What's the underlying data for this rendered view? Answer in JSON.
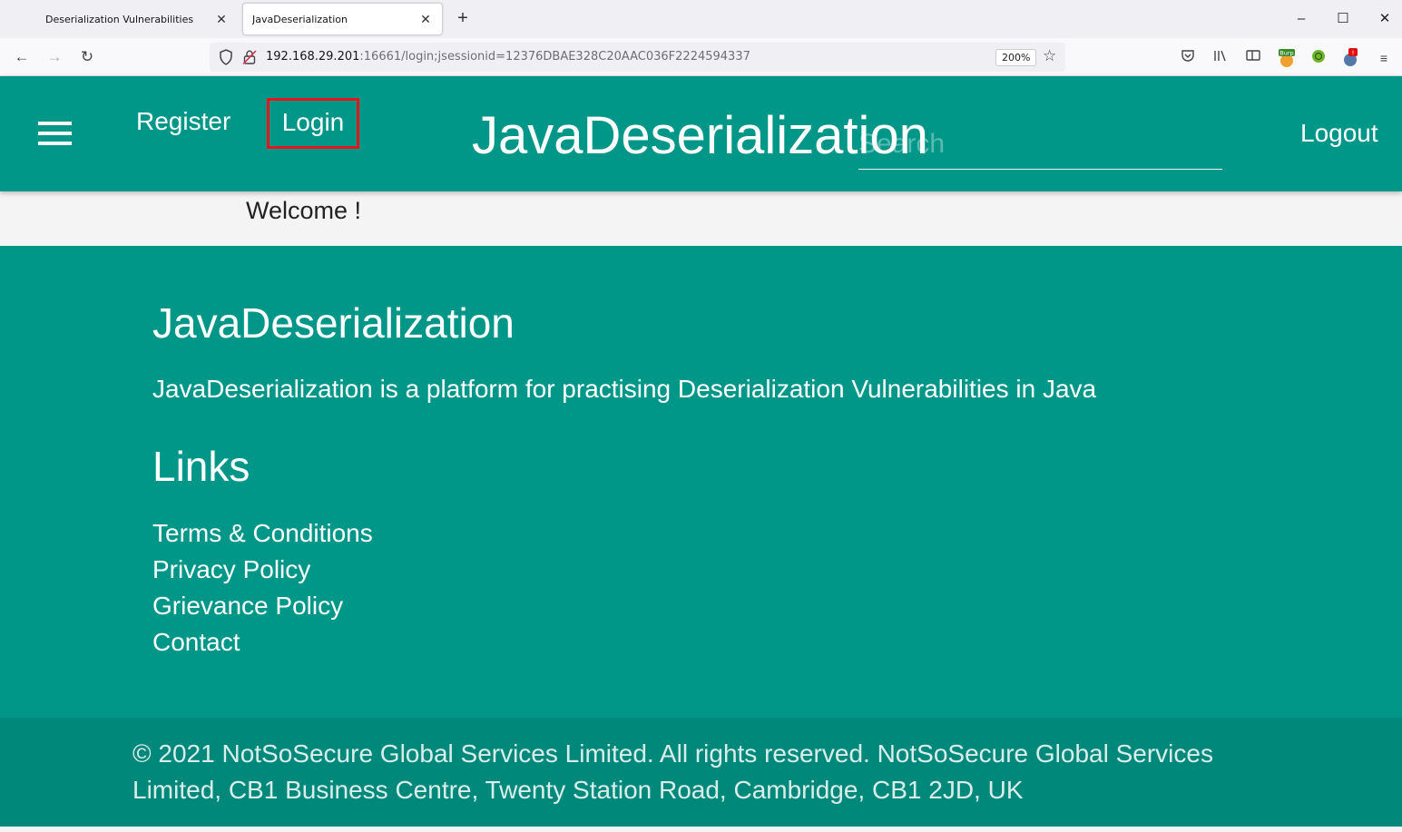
{
  "browser": {
    "tabs": [
      {
        "label": "Deserialization Vulnerabilities",
        "active": false
      },
      {
        "label": "JavaDeserialization",
        "active": true
      }
    ],
    "url_host": "192.168.29.201",
    "url_rest": ":16661/login;jsessionid=12376DBAE328C20AAC036F2224594337",
    "zoom": "200%"
  },
  "header": {
    "register": "Register",
    "login": "Login",
    "brand": "JavaDeserialization",
    "search_placeholder": "Search",
    "logout": "Logout"
  },
  "main": {
    "welcome": "Welcome !"
  },
  "footer": {
    "title": "JavaDeserialization",
    "description": "JavaDeserialization is a platform for practising Deserialization Vulnerabilities in Java",
    "links_title": "Links",
    "links": [
      "Terms & Conditions",
      "Privacy Policy",
      "Grievance Policy",
      "Contact"
    ],
    "copyright": "© 2021 NotSoSecure Global Services Limited. All rights reserved. NotSoSecure Global Services Limited, CB1 Business Centre, Twenty Station Road, Cambridge, CB1 2JD, UK"
  },
  "colors": {
    "header_bg": "#009688",
    "footer_bottom_bg": "#00897b",
    "highlight_border": "#e8141b"
  }
}
